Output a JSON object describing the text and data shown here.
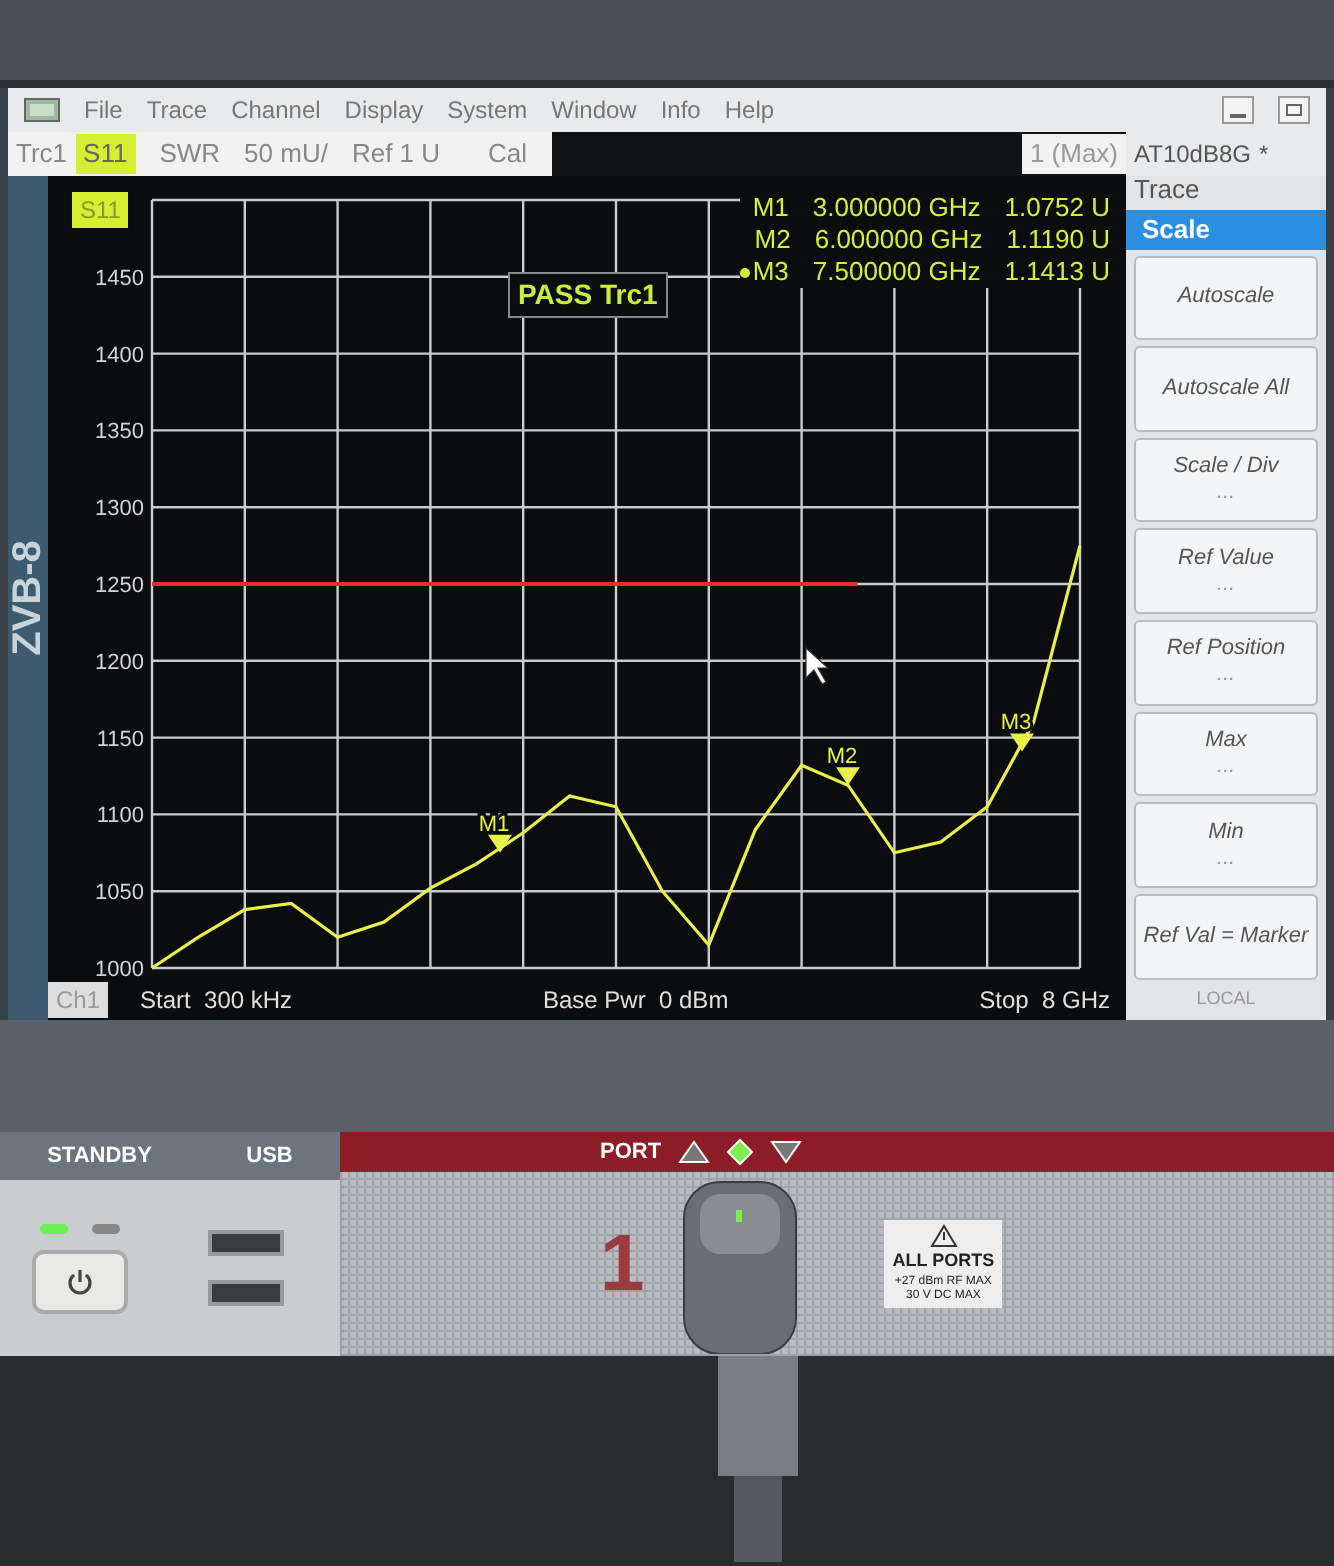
{
  "menu_bar": {
    "items": [
      "File",
      "Trace",
      "Channel",
      "Display",
      "System",
      "Window",
      "Info",
      "Help"
    ]
  },
  "trace_info": {
    "trace": "Trc1",
    "parameter": "S11",
    "format": "SWR",
    "scale": "50 mU/",
    "ref": "Ref 1 U",
    "cal": "Cal",
    "channel_mode": "1 (Max)"
  },
  "side_panel": {
    "setup": "AT10dB8G",
    "modified": "*",
    "menu": "Trace",
    "submenu": "Scale",
    "softkeys": [
      {
        "label": "Autoscale"
      },
      {
        "label": "Autoscale All"
      },
      {
        "label": "Scale / Div",
        "sub": "..."
      },
      {
        "label": "Ref Value",
        "sub": "..."
      },
      {
        "label": "Ref Position",
        "sub": "..."
      },
      {
        "label": "Max",
        "sub": "..."
      },
      {
        "label": "Min",
        "sub": "..."
      },
      {
        "label": "Ref Val = Marker"
      }
    ],
    "status": "LOCAL"
  },
  "body_logo": "ZVB-8",
  "diagram": {
    "trace_label": "S11",
    "limit_check": "PASS Trc1",
    "marker_readouts": [
      {
        "name": "M1",
        "frequency": "3.000000 GHz",
        "value": "1.0752 U",
        "active": false
      },
      {
        "name": "M2",
        "frequency": "6.000000 GHz",
        "value": "1.1190 U",
        "active": false
      },
      {
        "name": "M3",
        "frequency": "7.500000 GHz",
        "value": "1.1413 U",
        "active": true
      }
    ],
    "chart_data": {
      "type": "line",
      "categories": [
        null,
        null,
        null,
        null,
        null,
        null,
        null,
        null,
        null,
        null,
        null,
        null,
        null,
        null,
        null,
        null,
        null,
        null,
        null,
        null,
        null
      ],
      "series": [
        {
          "color": "#e8f04a",
          "values": [
            1000,
            1020,
            1038,
            1042,
            1020,
            1030,
            1052,
            1068,
            1088,
            1112,
            1105,
            1050,
            1015,
            1090,
            1132,
            1119,
            1075,
            1082,
            1105,
            1160,
            1275
          ]
        }
      ],
      "ylim": [
        1000,
        1500
      ],
      "yticks": [
        1000,
        1050,
        1100,
        1150,
        1200,
        1250,
        1300,
        1350,
        1400,
        1450
      ],
      "grid": true,
      "ref_lines": [
        {
          "axis": "y",
          "value": 1250,
          "color": "#e0301e"
        }
      ],
      "annotations": [
        {
          "text": "M1",
          "y": 1075
        },
        {
          "text": "M2",
          "y": 1119
        },
        {
          "text": "M3",
          "y": 1141
        }
      ]
    },
    "channel": "Ch1",
    "start": "Start  300 kHz",
    "power": "Base Pwr  0 dBm",
    "stop": "Stop  8 GHz"
  },
  "front_panel": {
    "standby": "STANDBY",
    "usb": "USB",
    "port_label": "PORT",
    "port_number": "1",
    "warning": {
      "title": "ALL PORTS",
      "line_1": "+27 dBm RF MAX",
      "line_2": "30 V DC MAX"
    }
  }
}
